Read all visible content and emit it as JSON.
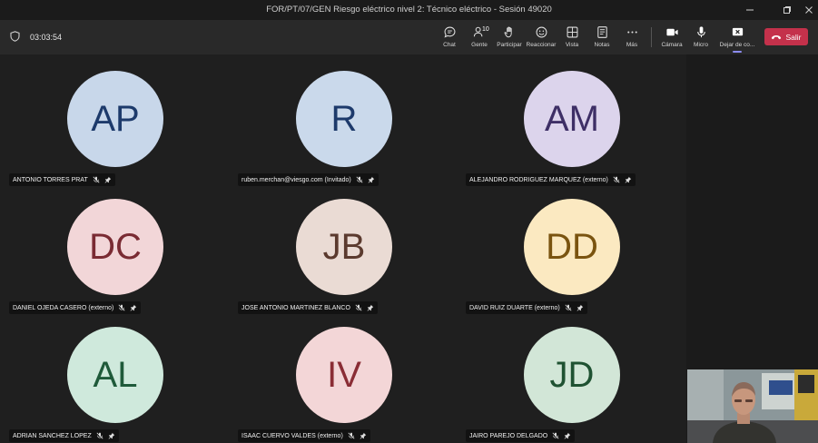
{
  "window": {
    "title": "FOR/PT/07/GEN Riesgo eléctrico nivel 2: Técnico eléctrico - Sesión 49020"
  },
  "meeting": {
    "timer": "03:03:54",
    "people_count": "10"
  },
  "toolbar": {
    "chat": "Chat",
    "people": "Gente",
    "raise": "Participar",
    "react": "Reaccionar",
    "view": "Vista",
    "notes": "Notas",
    "more": "Más",
    "camera": "Cámara",
    "mic": "Micro",
    "share": "Dejar de co...",
    "leave": "Salir"
  },
  "participants": [
    {
      "initials": "AP",
      "name": "ANTONIO TORRES PRAT",
      "bg": "#c8d7ea",
      "fg": "#1d3a6b"
    },
    {
      "initials": "R",
      "name": "ruben.merchan@viesgo.com (Invitado)",
      "bg": "#cad9eb",
      "fg": "#1d3a6b"
    },
    {
      "initials": "AM",
      "name": "ALEJANDRO RODRIGUEZ MARQUEZ (externo)",
      "bg": "#dcd4ec",
      "fg": "#3e2f66"
    },
    {
      "initials": "DC",
      "name": "DANIEL OJEDA CASERO (externo)",
      "bg": "#f2d6d8",
      "fg": "#7a2b33"
    },
    {
      "initials": "JB",
      "name": "JOSE ANTONIO MARTINEZ BLANCO",
      "bg": "#eadbd4",
      "fg": "#5b3a2e"
    },
    {
      "initials": "DD",
      "name": "DAVID RUIZ DUARTE (externo)",
      "bg": "#fbe9c1",
      "fg": "#7a5410"
    },
    {
      "initials": "AL",
      "name": "ADRIAN SANCHEZ LOPEZ",
      "bg": "#cfe9dc",
      "fg": "#1f5a3a"
    },
    {
      "initials": "IV",
      "name": "ISAAC CUERVO VALDES (externo)",
      "bg": "#f3d6d7",
      "fg": "#8a2d35"
    },
    {
      "initials": "JD",
      "name": "JAIRO PAREJO DELGADO",
      "bg": "#d2e6d7",
      "fg": "#1f5232"
    }
  ]
}
